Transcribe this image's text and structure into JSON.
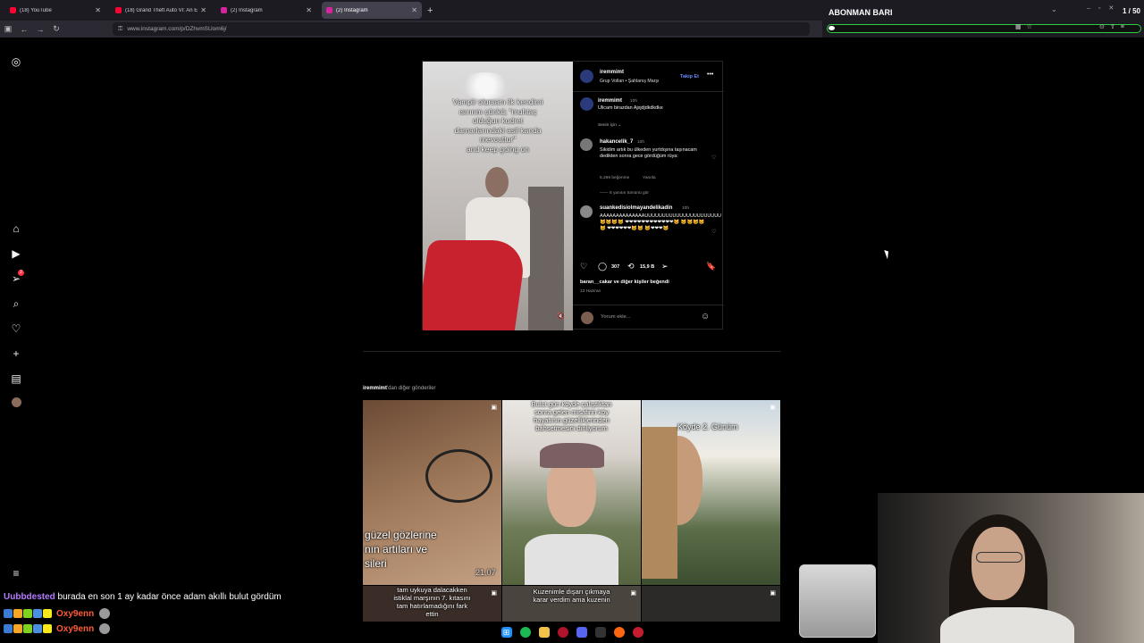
{
  "browser": {
    "tabs": [
      {
        "label": "(18) YouTube",
        "fav_color": "#ff0033",
        "active": false
      },
      {
        "label": "(18) Grand Theft Auto VI: An E",
        "fav_color": "#ff0033",
        "active": false
      },
      {
        "label": "(2) Instagram",
        "fav_color": "#d6249f",
        "active": false
      },
      {
        "label": "(2) Instagram",
        "fav_color": "#d6249f",
        "active": true
      }
    ],
    "url": "www.instagram.com/p/DZhvmSUom6j/"
  },
  "overlay": {
    "title": "ABONMAN BARI",
    "count": "1 / 50",
    "progress_fraction": 0.02
  },
  "post": {
    "caption_lines": [
      "Vampir olursam ilk kendimi",
      "ısırırım çünkü; \"muhtaç",
      "olduğun kudret",
      "damarlarındaki asil kanda",
      "mevcuttur\"",
      "and keep going on"
    ],
    "author": "iremmimt",
    "author_sub": "Grup Vollan • Şahlanış Marşı",
    "follow_label": "Takip Et",
    "desc_user": "iremmimt",
    "desc_time": "10h",
    "desc_text": "Ulicam birazdan Ajxjdjdkdkdke",
    "for_you": "Senin için",
    "comments": [
      {
        "user": "hakancelik_7",
        "time": "10h",
        "text": "Sikidim artık bu ülkeden yurtdışına taşınacam dedikten sonra gece gördüğüm rüya:",
        "likes": "5.269 beğenme",
        "reply": "Yanıtla",
        "view_replies": "8 yanıtın tümünü gör"
      },
      {
        "user": "suankedisiolmayandelikadin",
        "time": "10h",
        "text": "AAAAAAAAAAAAAAUUUUUUUUUUUUUUUUUUUUUU 🐱🐱🐱🐱 ❤❤❤❤❤❤❤❤❤❤❤❤🐱 🐱🐱🐱🐱🐱 ❤❤❤❤❤❤🐱🐱 🐱❤❤❤🐱"
      }
    ],
    "comment_count": "307",
    "repost_count": "15,9 B",
    "liked_by_user": "baran__cakar",
    "liked_by_text": " ve diğer kişiler beğendi",
    "date": "13 Haziran",
    "add_comment_placeholder": "Yorum ekle..."
  },
  "more": {
    "user": "iremmimt",
    "label": "'dan diğer gönderiler",
    "tiles": [
      {
        "caption": "güzel gözlerine\nnın artıları ve\nsileri",
        "date": "21.07"
      },
      {
        "caption": "Bulut gün köyde çalıştıktan\nsonra gelen misafirin köy\nhayatının güzelliklerinden\nbahsetmesini dinliyorum"
      },
      {
        "caption": "Köyde 2. Günüm"
      },
      {
        "caption": "tam uykuya dalacakken\nistiklal marşının 7. kıtasını\ntam hatırlamadığını fark\nettin"
      },
      {
        "caption": "Kuzenimle dışarı çıkmaya\nkarar verdim ama kuzenin"
      },
      {
        "caption": ""
      }
    ]
  },
  "chat": {
    "line1_user": "Uubbdested",
    "line1_text": " burada en son 1 ay kadar önce adam akıllı bulut gördüm",
    "line2_user": "Oxy9enn",
    "line3_user": "Oxy9enn"
  }
}
